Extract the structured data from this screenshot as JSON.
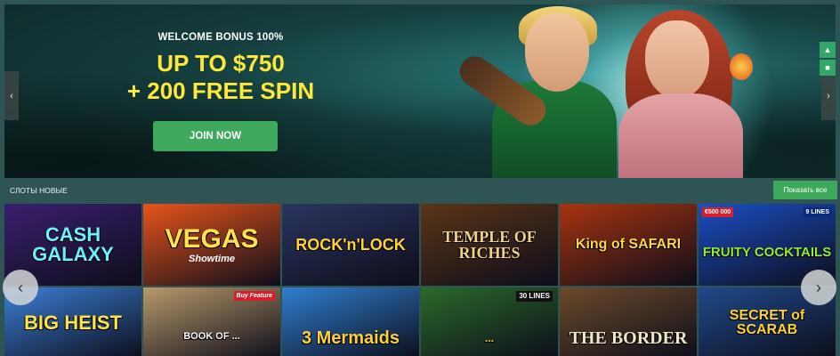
{
  "banner": {
    "bonus_label": "WELCOME BONUS 100%",
    "headline_line1": "UP TO $750",
    "headline_line2": "+ 200 FREE SPIN",
    "join_button": "JOIN NOW",
    "prev_icon": "chevron-left-icon",
    "next_icon": "chevron-right-icon",
    "side_tools": [
      "trophy-icon",
      "tournament-icon"
    ]
  },
  "section": {
    "title": "СЛОТЫ НОВЫЕ",
    "show_all": "Показать все"
  },
  "games": [
    {
      "title": "CASH GALAXY",
      "bg": "#3a1f6e",
      "fg": "#6ef0ff"
    },
    {
      "title": "VEGAS",
      "subtitle": "Showtime",
      "bg": "#e8541a",
      "fg": "#ffe24a"
    },
    {
      "title": "ROCK'n'LOCK",
      "bg": "#2b3560",
      "fg": "#ffd23a"
    },
    {
      "title": "TEMPLE OF RICHES",
      "bg": "#5a3516",
      "fg": "#f2d28a"
    },
    {
      "title": "King of SAFARI",
      "bg": "#a8340f",
      "fg": "#ffd54a"
    },
    {
      "title": "FRUITY COCKTAILS",
      "badge_top": "€500 000",
      "badge_lines": "9 LINES",
      "bg": "#1a4fc4",
      "fg": "#8ef03a"
    },
    {
      "title": "BIG HEIST",
      "bg": "#3b7fd6",
      "fg": "#ffe34a"
    },
    {
      "title": "BOOK OF ...",
      "badge": "Buy Feature",
      "bg": "#b89a6a",
      "fg": "#ffffff"
    },
    {
      "title": "3 Mermaids",
      "bg": "#2f7fd0",
      "fg": "#ffd23a"
    },
    {
      "title": "...",
      "badge": "30 LINES",
      "bg": "#2a6a2a",
      "fg": "#ffd23a"
    },
    {
      "title": "THE BORDER",
      "bg": "#6b4a2a",
      "fg": "#f0e6c8"
    },
    {
      "title": "SECRET of SCARAB",
      "bg": "#1f4a8a",
      "fg": "#ffd23a"
    }
  ],
  "carousel": {
    "prev_icon": "arrow-left-icon",
    "next_icon": "arrow-right-icon"
  }
}
